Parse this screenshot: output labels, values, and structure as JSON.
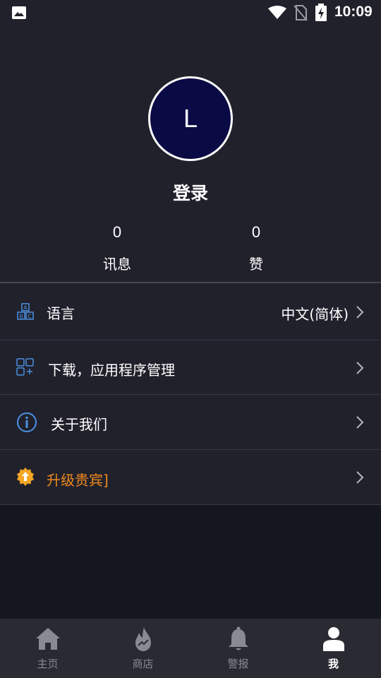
{
  "status_bar": {
    "time": "10:09",
    "icons": [
      "image-icon",
      "wifi-icon",
      "no-sim-icon",
      "battery-charging-icon"
    ]
  },
  "profile": {
    "avatar_letter": "L",
    "login_label": "登录",
    "stats": [
      {
        "count": "0",
        "label": "讯息"
      },
      {
        "count": "0",
        "label": "赞"
      }
    ]
  },
  "menu": {
    "language": {
      "label": "语言",
      "value": "中文(简体)",
      "icon": "abc-blocks-icon"
    },
    "downloads": {
      "label": "下载，应用程序管理",
      "icon": "apps-grid-icon"
    },
    "about": {
      "label": "关于我们",
      "icon": "info-icon"
    },
    "vip": {
      "label": "升级贵宾]",
      "icon": "upgrade-badge-icon"
    }
  },
  "bottom_nav": {
    "items": [
      {
        "label": "主页",
        "icon": "home-icon",
        "active": false
      },
      {
        "label": "商店",
        "icon": "flame-icon",
        "active": false
      },
      {
        "label": "警报",
        "icon": "bell-icon",
        "active": false
      },
      {
        "label": "我",
        "icon": "person-icon",
        "active": true
      }
    ]
  },
  "colors": {
    "background": "#21212c",
    "avatar_fill": "#0a0a45",
    "accent_icon": "#4a90e2",
    "vip_orange": "#f08a1c",
    "nav_bg": "#2a2a33",
    "nav_inactive": "#8a8a92"
  }
}
